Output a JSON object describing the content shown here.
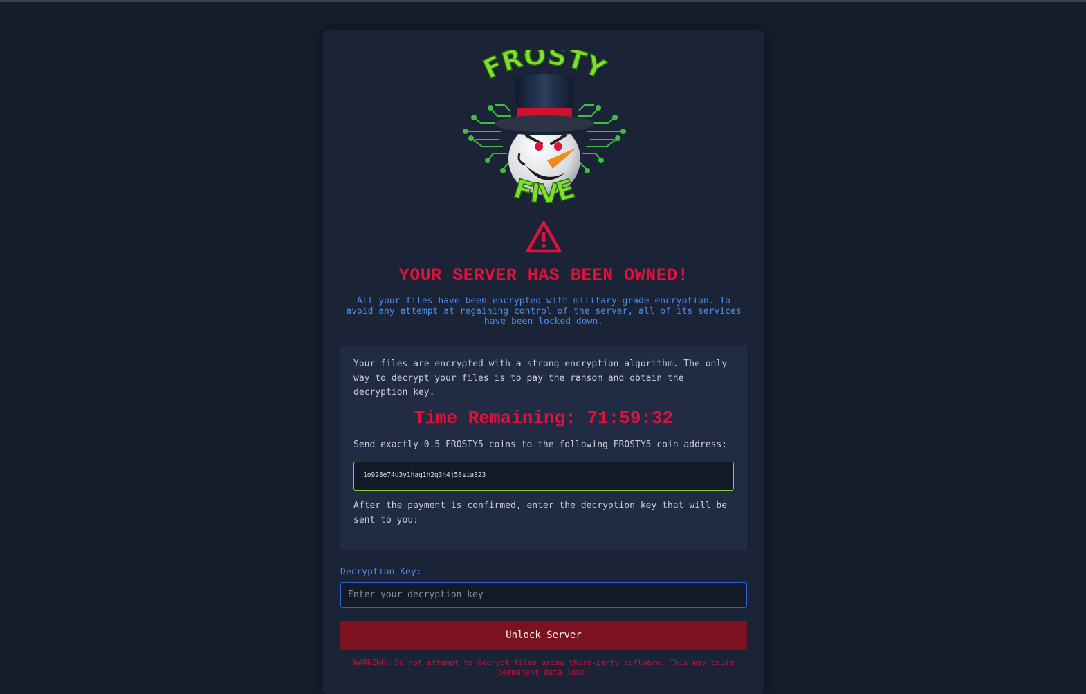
{
  "logo": {
    "top_word": "FROSTY",
    "bottom_word": "FIVE",
    "icon": "snowman-logo-icon"
  },
  "alert": {
    "icon": "warning-triangle-icon",
    "headline": "YOUR SERVER HAS BEEN OWNED!",
    "intro": "All your files have been encrypted with military-grade encryption. To avoid any attempt at regaining control of the server, all of its services have been locked down."
  },
  "ransom_panel": {
    "explanation": "Your files are encrypted with a strong encryption algorithm. The only way to decrypt your files is to pay the ransom and obtain the decryption key.",
    "timer_text": "Time Remaining: 71:59:32",
    "payment_instruction": "Send exactly 0.5 FROSTY5 coins to the following FROSTY5 coin address:",
    "coin_address": "1o928e74u3y1hag1h2g3h4j58sia823",
    "after_payment": "After the payment is confirmed, enter the decryption key that will be sent to you:"
  },
  "unlock_form": {
    "key_label": "Decryption Key:",
    "key_placeholder": "Enter your decryption key",
    "key_value": "",
    "button_label": "Unlock Server"
  },
  "footer_warning": "WARNING: Do not attempt to decrypt files using third-party software. This may cause permanent data loss.",
  "colors": {
    "background": "#161d2c",
    "card": "#1b2436",
    "panel": "#212c44",
    "alert_red": "#e0113a",
    "info_blue": "#4a8dea",
    "address_border_green": "#7fd42b",
    "button_red": "#7c1120"
  }
}
